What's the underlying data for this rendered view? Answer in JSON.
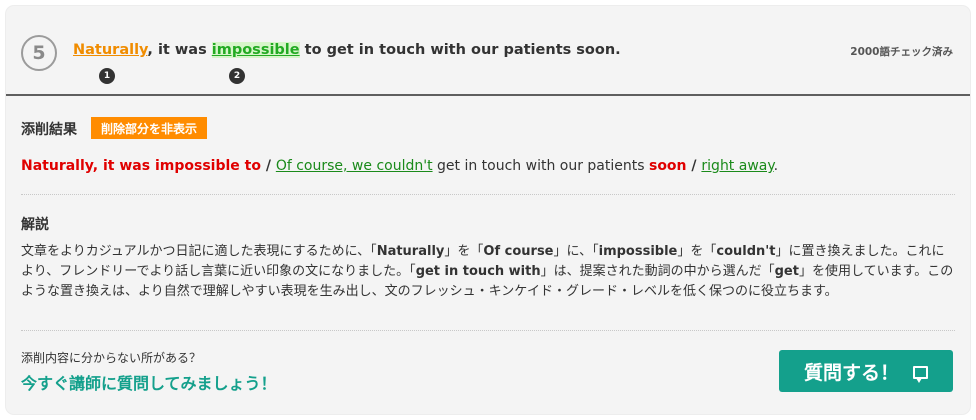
{
  "item": {
    "number": "5",
    "checked_label": "2000語チェック済み",
    "sentence": {
      "highlight1": "Naturally",
      "part1": ", it was ",
      "highlight2": "impossible",
      "part2": " to get in touch with our patients soon."
    },
    "markers": [
      "1",
      "2"
    ]
  },
  "result": {
    "title": "添削結果",
    "toggle_label": "削除部分を非表示",
    "del1": "Naturally, it was impossible to",
    "sep1": " / ",
    "ins1": "Of course, we couldn't",
    "mid": " get in touch with our patients ",
    "del2": "soon",
    "sep2": " / ",
    "ins2": "right away",
    "end": "."
  },
  "explanation": {
    "title": "解説",
    "t1": "文章をよりカジュアルかつ日記に適した表現にするために、「",
    "b1": "Naturally",
    "t2": "」を「",
    "b2": "Of course",
    "t3": "」に、「",
    "b3": "impossible",
    "t4": "」を「",
    "b4": "couldn't",
    "t5": "」に置き換えました。これにより、フレンドリーでより話し言葉に近い印象の文になりました。「",
    "b5": "get in touch with",
    "t6": "」は、提案された動詞の中から選んだ「",
    "b6": "get",
    "t7": "」を使用しています。このような置き換えは、より自然で理解しやすい表現を生み出し、文のフレッシュ・キンケイド・グレード・レベルを低く保つのに役立ちます。"
  },
  "footer": {
    "question": "添削内容に分からない所がある？",
    "cta": "今すぐ講師に質問してみましょう！",
    "ask_button": "質問する！",
    "ask_icon": "chat-bubble-icon"
  },
  "colors": {
    "deleted": "#e00000",
    "inserted": "#1a8a1a",
    "accent_orange": "#ff8c00",
    "accent_teal": "#14a08c"
  }
}
